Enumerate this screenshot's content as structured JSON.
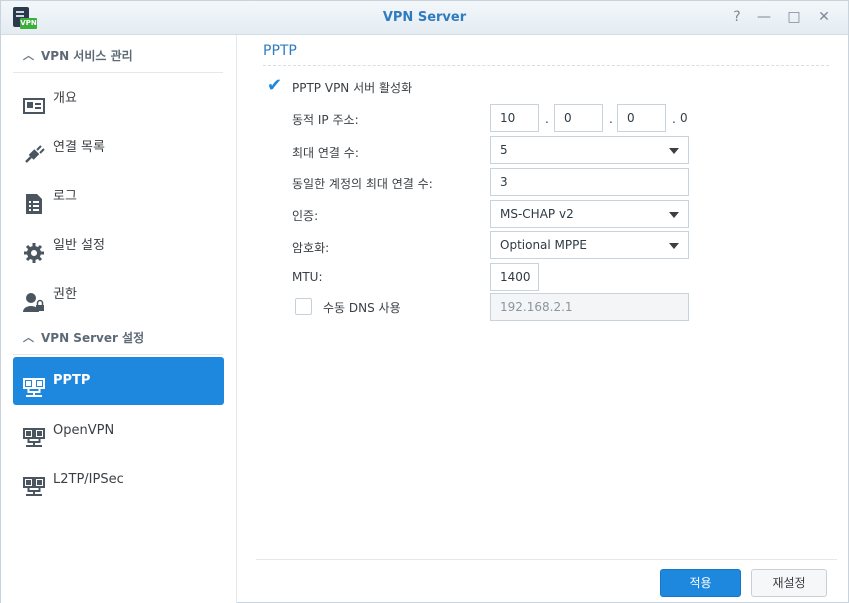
{
  "window": {
    "title": "VPN Server",
    "app_icon_tag": "VPN",
    "controls": {
      "help": "?",
      "minimize": "—",
      "maximize": "□",
      "close": "✕"
    }
  },
  "sidebar": {
    "section_manage": "VPN 서비스 관리",
    "manage_items": [
      {
        "label": "개요",
        "icon": "overview-icon"
      },
      {
        "label": "연결 목록",
        "icon": "connection-list-icon"
      },
      {
        "label": "로그",
        "icon": "log-icon"
      },
      {
        "label": "일반 설정",
        "icon": "gear-icon"
      },
      {
        "label": "권한",
        "icon": "user-lock-icon"
      }
    ],
    "section_server": "VPN Server 설정",
    "server_items": [
      {
        "label": "PPTP",
        "icon": "network-icon",
        "active": true
      },
      {
        "label": "OpenVPN",
        "icon": "network-icon",
        "active": false
      },
      {
        "label": "L2TP/IPSec",
        "icon": "network-icon",
        "active": false
      }
    ]
  },
  "main": {
    "page_title": "PPTP",
    "enable_label": "PPTP VPN 서버 활성화",
    "enable_checked": true,
    "dynamic_ip": {
      "label": "동적 IP 주소:",
      "octets": [
        "10",
        "0",
        "0"
      ],
      "last_octet": "0",
      "separator": "."
    },
    "max_connections": {
      "label": "최대 연결 수:",
      "value": "5"
    },
    "max_same_account": {
      "label": "동일한 계정의 최대 연결 수:",
      "value": "3"
    },
    "auth": {
      "label": "인증:",
      "value": "MS-CHAP v2"
    },
    "encryption": {
      "label": "암호화:",
      "value": "Optional MPPE"
    },
    "mtu": {
      "label": "MTU:",
      "value": "1400"
    },
    "manual_dns": {
      "label": "수동 DNS 사용",
      "checked": false,
      "value": "192.168.2.1"
    }
  },
  "footer": {
    "apply": "적용",
    "reset": "재설정"
  },
  "colors": {
    "accent": "#1d88dd",
    "title": "#2f7bc0"
  }
}
